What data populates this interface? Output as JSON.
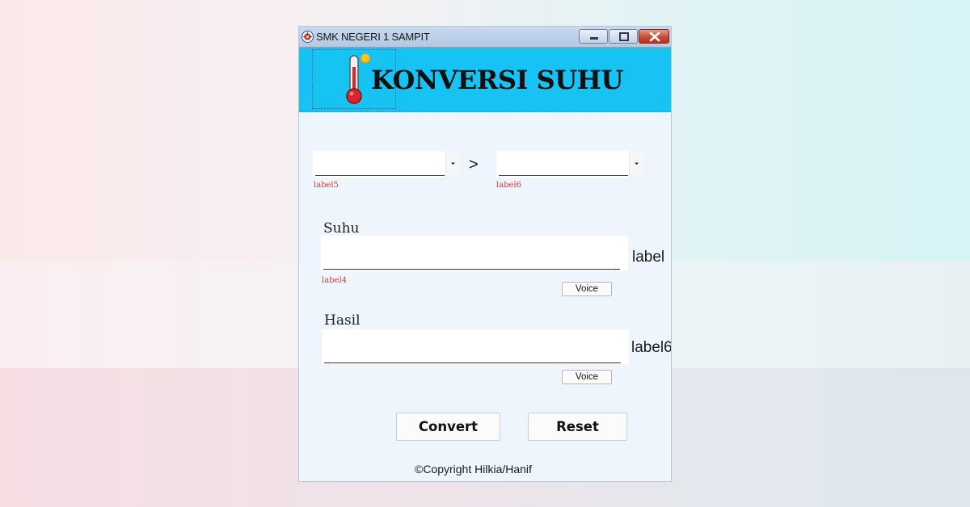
{
  "window": {
    "title": "SMK NEGERI 1 SAMPIT"
  },
  "banner": {
    "title": "KONVERSI SUHU",
    "icon": "thermometer-icon",
    "colors": {
      "background": "#17C3F2"
    }
  },
  "conversion": {
    "from_unit": {
      "value": "",
      "label": "label5"
    },
    "separator": ">",
    "to_unit": {
      "value": "",
      "label": "label6"
    }
  },
  "suhu": {
    "label": "Suhu",
    "value": "",
    "unit_label": "label",
    "status_label": "label4",
    "voice_label": "Voice"
  },
  "hasil": {
    "label": "Hasil",
    "value": "",
    "unit_label": "label6",
    "voice_label": "Voice"
  },
  "actions": {
    "convert_label": "Convert",
    "reset_label": "Reset"
  },
  "footer": {
    "copyright": "©Copyright Hilkia/Hanif"
  }
}
